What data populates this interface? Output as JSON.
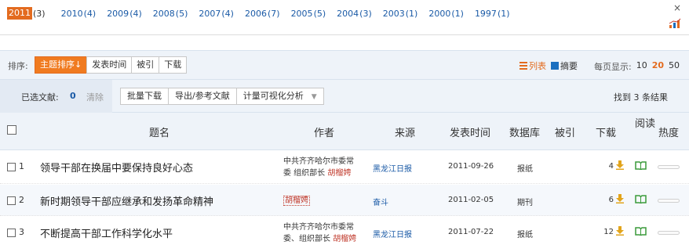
{
  "years": [
    {
      "year": "2011",
      "count": "(3)",
      "active": true
    },
    {
      "year": "2010",
      "count": "(4)"
    },
    {
      "year": "2009",
      "count": "(4)"
    },
    {
      "year": "2008",
      "count": "(5)"
    },
    {
      "year": "2007",
      "count": "(4)"
    },
    {
      "year": "2006",
      "count": "(7)"
    },
    {
      "year": "2005",
      "count": "(5)"
    },
    {
      "year": "2004",
      "count": "(3)"
    },
    {
      "year": "2003",
      "count": "(1)"
    },
    {
      "year": "2000",
      "count": "(1)"
    },
    {
      "year": "1997",
      "count": "(1)"
    }
  ],
  "year_close": "×",
  "sort": {
    "label": "排序:",
    "buttons": [
      "主题排序",
      "发表时间",
      "被引",
      "下载"
    ],
    "active_arrow": "↓"
  },
  "view": {
    "list": "列表",
    "abstract": "摘要"
  },
  "per_page": {
    "label": "每页显示:",
    "options": [
      "10",
      "20",
      "50"
    ],
    "active": "20"
  },
  "selection": {
    "label": "已选文献:",
    "count": "0",
    "clear": "清除",
    "actions": [
      "批量下载",
      "导出/参考文献",
      "计量可视化分析"
    ],
    "found": "找到 3 条结果"
  },
  "table": {
    "headers": {
      "title": "题名",
      "author": "作者",
      "source": "来源",
      "date": "发表时间",
      "database": "数据库",
      "cited": "被引",
      "download": "下载",
      "read": "阅读",
      "heat": "热度"
    },
    "rows": [
      {
        "index": "1",
        "title": "领导干部在换届中要保持良好心态",
        "author_line1": "中共齐齐哈尔市委常",
        "author_line2": "委 组织部长",
        "author_name": "胡榴娉",
        "source": "黑龙江日报",
        "date": "2011-09-26",
        "database": "报纸",
        "cited": "",
        "downloads": "4"
      },
      {
        "index": "2",
        "title": "新时期领导干部应继承和发扬革命精神",
        "author_line1": "",
        "author_line2": "",
        "author_name": "胡榴娉",
        "source": "奋斗",
        "date": "2011-02-05",
        "database": "期刊",
        "cited": "",
        "downloads": "6"
      },
      {
        "index": "3",
        "title": "不断提高干部工作科学化水平",
        "author_line1": "中共齐齐哈尔市委常",
        "author_line2": "委、组织部长",
        "author_name": "胡榴娉",
        "source": "黑龙江日报",
        "date": "2011-07-22",
        "database": "报纸",
        "cited": "",
        "downloads": "12"
      }
    ]
  },
  "icons": {
    "close": "close-icon",
    "chart": "bar-chart-icon",
    "download": "download-arrow-icon",
    "read": "open-book-icon"
  },
  "colors": {
    "accent": "#e36b1f",
    "link": "#1a5aa6",
    "header_bg": "#eef3f9",
    "read_green": "#3a9a3a",
    "download_gold": "#e2a41b"
  }
}
